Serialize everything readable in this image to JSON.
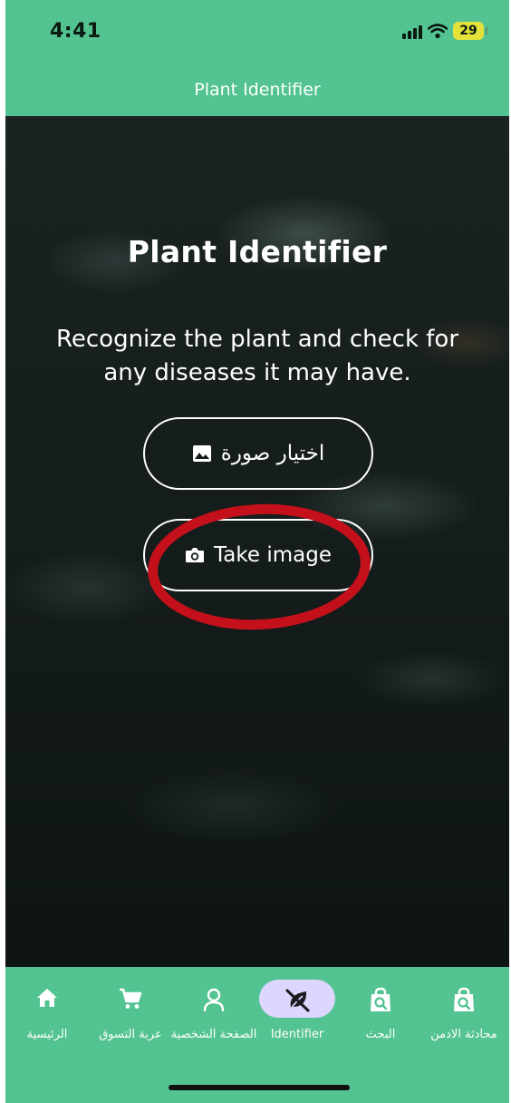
{
  "status_bar": {
    "time": "4:41",
    "battery": "29"
  },
  "header": {
    "title": "Plant Identifier"
  },
  "hero": {
    "title": "Plant Identifier",
    "description": "Recognize the plant and check for any diseases it may have.",
    "pick_image_label": "اختيار صورة",
    "take_image_label": "Take image"
  },
  "nav": {
    "items": [
      {
        "label": "الرئيسية",
        "icon": "home-icon"
      },
      {
        "label": "عربة التسوق",
        "icon": "cart-icon"
      },
      {
        "label": "الصفحة الشخصية",
        "icon": "profile-icon"
      },
      {
        "label": "Identifier",
        "icon": "leaf-off-icon",
        "active": true
      },
      {
        "label": "البحث",
        "icon": "search-bag-icon"
      },
      {
        "label": "محادثة الادمن",
        "icon": "search-bag-icon"
      }
    ]
  },
  "colors": {
    "primary": "#53c391",
    "active_pill": "#ddd6ff",
    "annotation": "#c4101a",
    "battery": "#e4e23a"
  }
}
